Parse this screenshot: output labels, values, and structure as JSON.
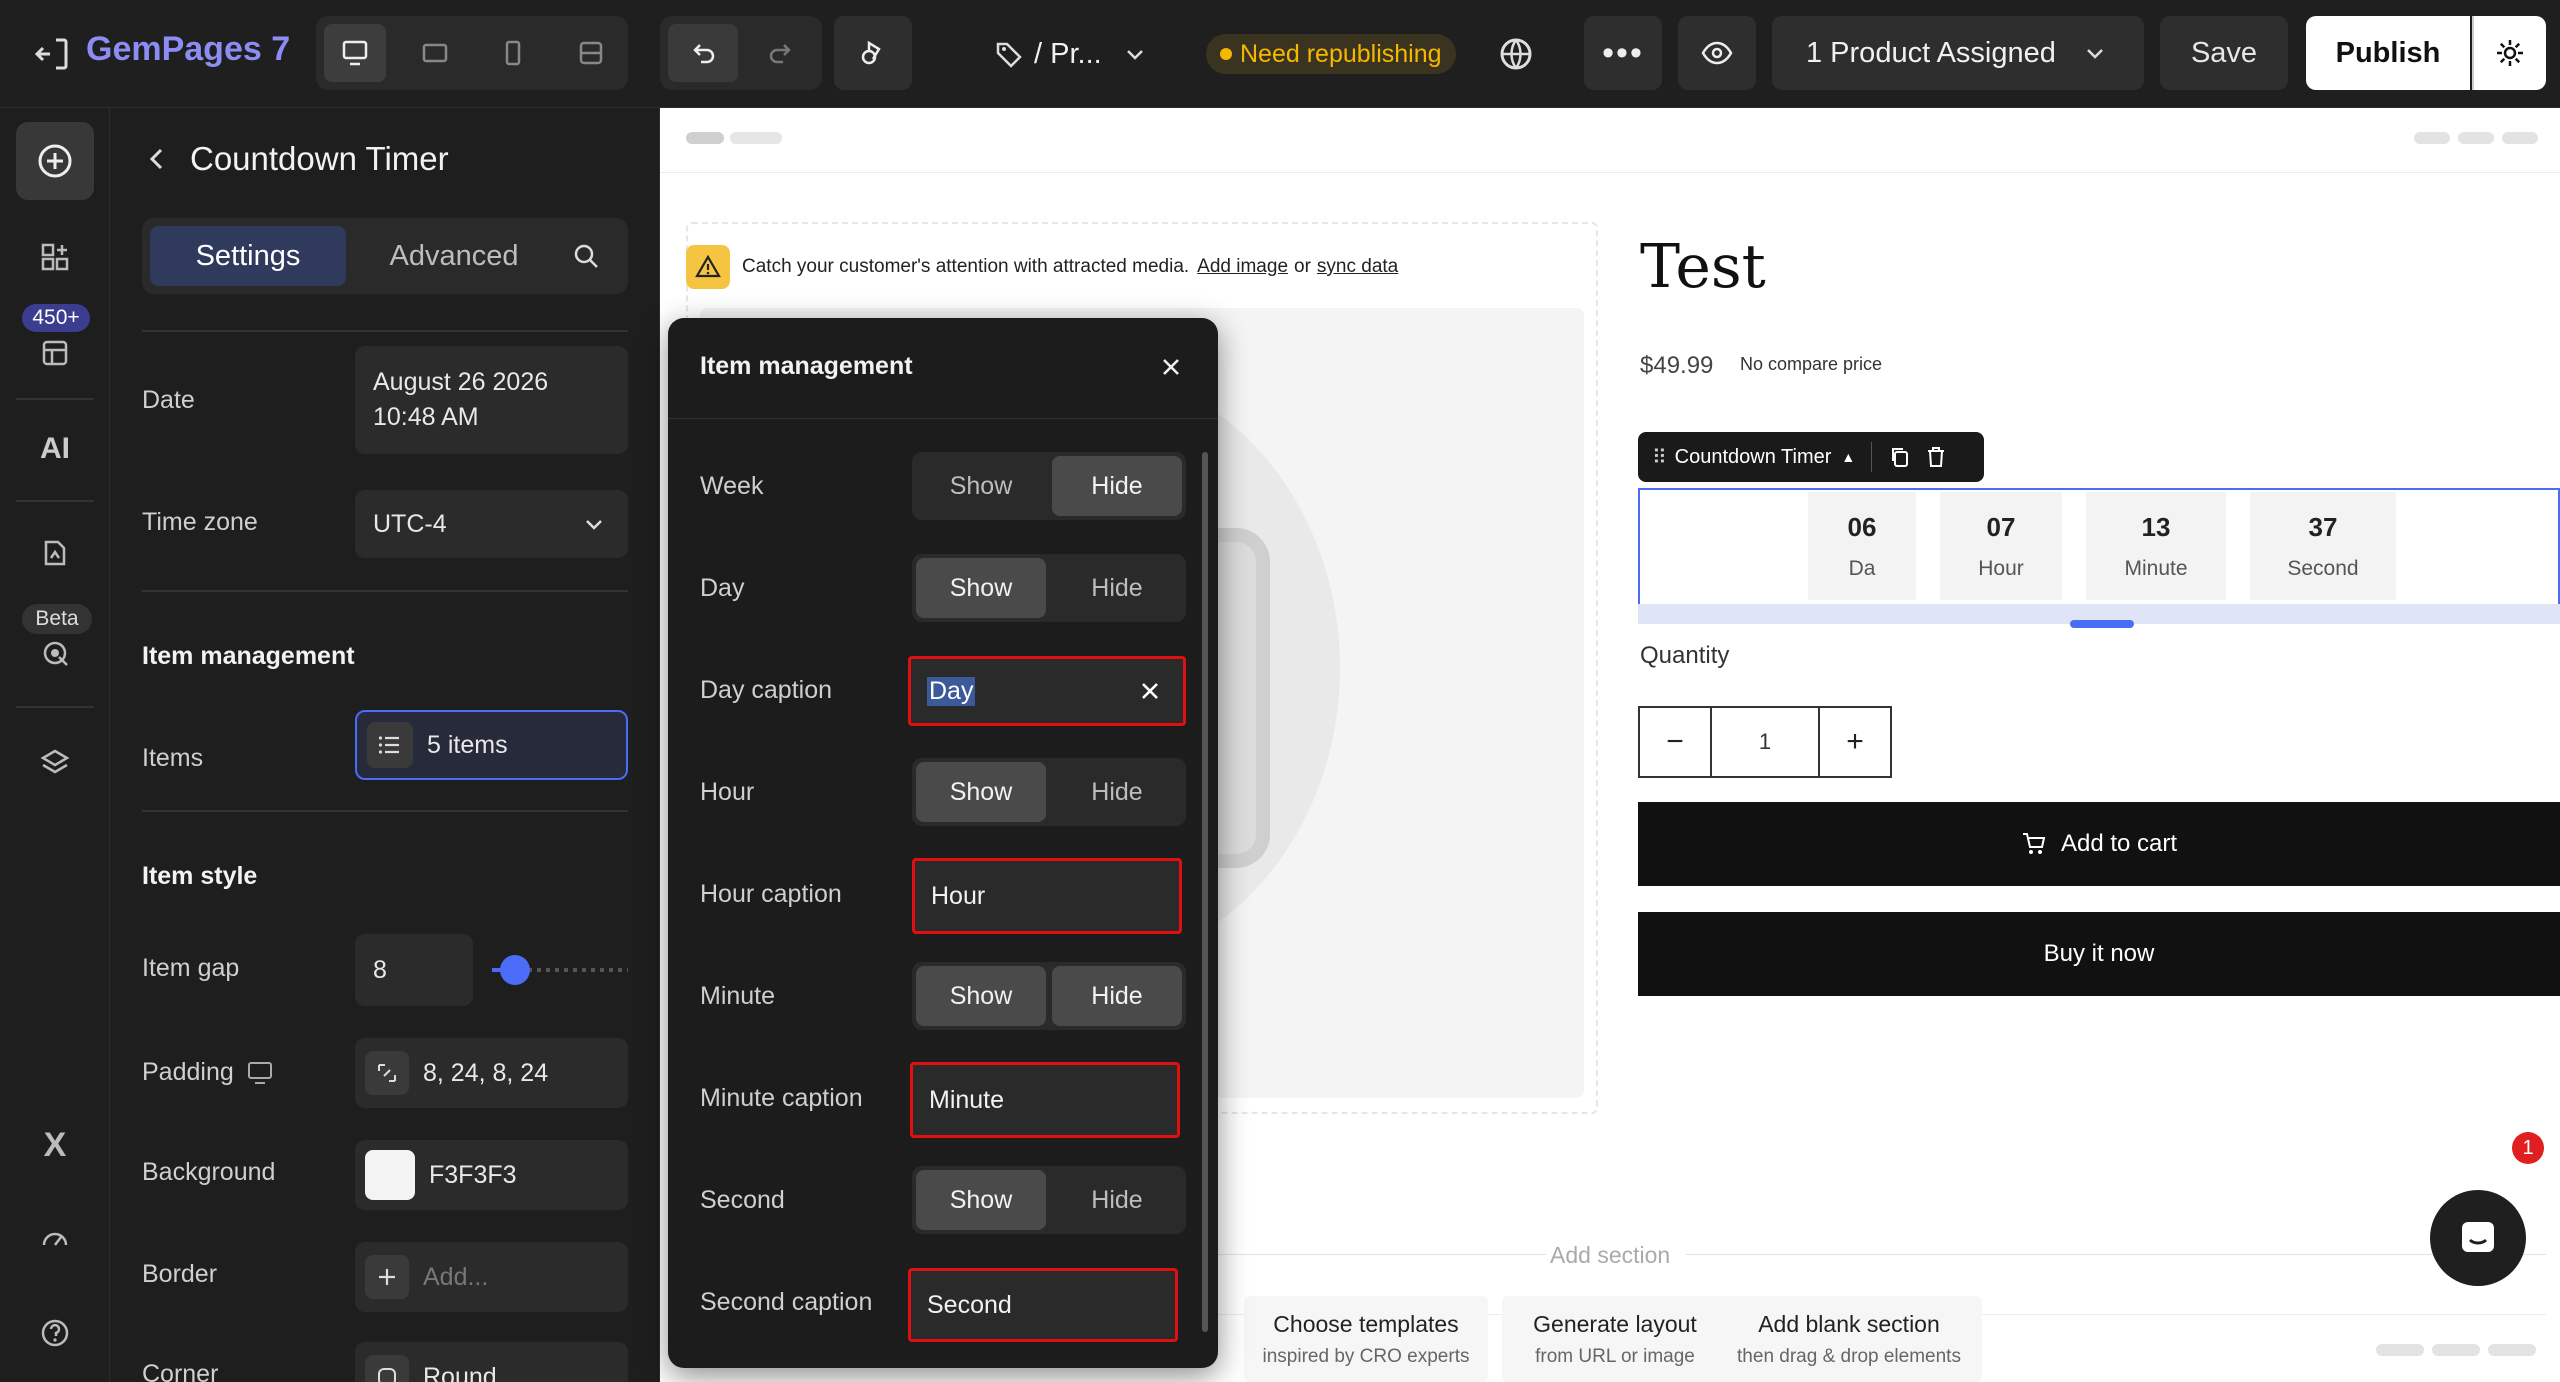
{
  "topbar": {
    "brand": "GemPages 7",
    "page_name": "/ Pr...",
    "status_badge": "Need republishing",
    "product_assigned": "1 Product Assigned",
    "save_label": "Save",
    "publish_label": "Publish",
    "colors": {
      "badge_bg": "#3a3320",
      "badge_text": "#f5b800"
    }
  },
  "rail": {
    "badge_count": "450+",
    "beta_label": "Beta",
    "ai_label": "AI"
  },
  "panel": {
    "title": "Countdown Timer",
    "tabs": {
      "settings": "Settings",
      "advanced": "Advanced"
    },
    "date_label": "Date",
    "date_value_line1": "August 26 2026",
    "date_value_line2": "10:48 AM",
    "timezone_label": "Time zone",
    "timezone_value": "UTC-4",
    "item_management_title": "Item management",
    "items_label": "Items",
    "items_value": "5 items",
    "item_style_title": "Item style",
    "item_gap_label": "Item gap",
    "item_gap_value": "8",
    "item_gap_slider_level": 0.08,
    "padding_label": "Padding",
    "padding_value": "8, 24, 8, 24",
    "background_label": "Background",
    "background_value": "F3F3F3",
    "border_label": "Border",
    "border_placeholder": "Add...",
    "corner_label": "Corner",
    "corner_value": "Round"
  },
  "popup": {
    "title": "Item management",
    "rows": {
      "week_label": "Week",
      "day_label": "Day",
      "day_caption_label": "Day caption",
      "day_caption_value": "Day",
      "hour_label": "Hour",
      "hour_caption_label": "Hour caption",
      "hour_caption_value": "Hour",
      "minute_label": "Minute",
      "minute_caption_label": "Minute caption",
      "minute_caption_value": "Minute",
      "second_label": "Second",
      "second_caption_label": "Second caption",
      "second_caption_value": "Second"
    },
    "show_label": "Show",
    "hide_label": "Hide"
  },
  "canvas": {
    "notice_text": "Catch your customer's attention with attracted media.",
    "notice_add_image": "Add image",
    "notice_or": "or",
    "notice_sync": "sync data",
    "product_title": "Test",
    "price": "$49.99",
    "compare_price": "No compare price",
    "element_tag": "Countdown Timer",
    "countdown": [
      {
        "num": "06",
        "cap": "Da"
      },
      {
        "num": "07",
        "cap": "Hour"
      },
      {
        "num": "13",
        "cap": "Minute"
      },
      {
        "num": "37",
        "cap": "Second"
      }
    ],
    "quantity_label": "Quantity",
    "quantity_value": "1",
    "add_to_cart": "Add to cart",
    "buy_now": "Buy it now",
    "add_section": "Add section",
    "section_options": [
      {
        "title": "Choose templates",
        "sub": "inspired by CRO experts"
      },
      {
        "title": "Generate layout",
        "sub": "from URL or image"
      },
      {
        "title": "Add blank section",
        "sub": "then drag & drop elements"
      }
    ],
    "chat_badge": "1"
  }
}
